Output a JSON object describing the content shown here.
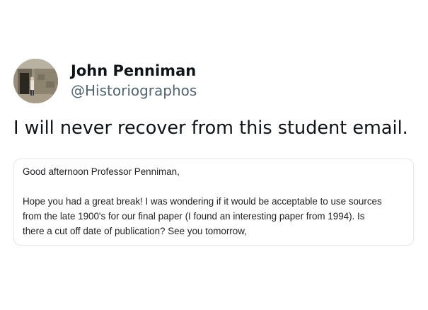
{
  "author": {
    "name": "John Penniman",
    "handle": "@Historiographos",
    "avatar_icon": "profile-photo-stone-doorway"
  },
  "tweet": {
    "text": "I will never recover from this student email."
  },
  "email": {
    "greeting": "Good afternoon Professor Penniman,",
    "lines": [
      "Hope you had a great break! I was wondering if it would be acceptable to use sources",
      "from the late 1900's for our final paper (I found an interesting paper from 1994). Is",
      "there a cut off date of publication? See you tomorrow,"
    ]
  },
  "colors": {
    "text_primary": "#0f1419",
    "text_secondary": "#536471",
    "card_border": "#e6e8ea"
  }
}
